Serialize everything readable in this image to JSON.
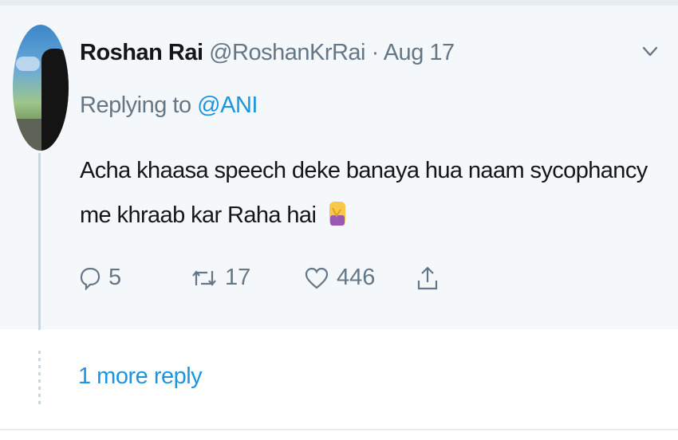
{
  "tweet": {
    "author_name": "Roshan Rai",
    "author_handle": "@RoshanKrRai",
    "separator": "·",
    "date": "Aug 17",
    "replying_prefix": "Replying to",
    "replying_to": "@ANI",
    "text": "Acha khaasa speech deke banaya hua naam sycophancy me khraab kar Raha hai",
    "emoji": "woman-facepalming-emoji",
    "avatar": "user-avatar-photo"
  },
  "actions": {
    "reply_count": "5",
    "retweet_count": "17",
    "like_count": "446"
  },
  "thread": {
    "more_replies_label": "1 more reply"
  },
  "colors": {
    "link": "#1b95e0",
    "secondary_text": "#657786",
    "tweet_background": "#f5f8fa"
  }
}
